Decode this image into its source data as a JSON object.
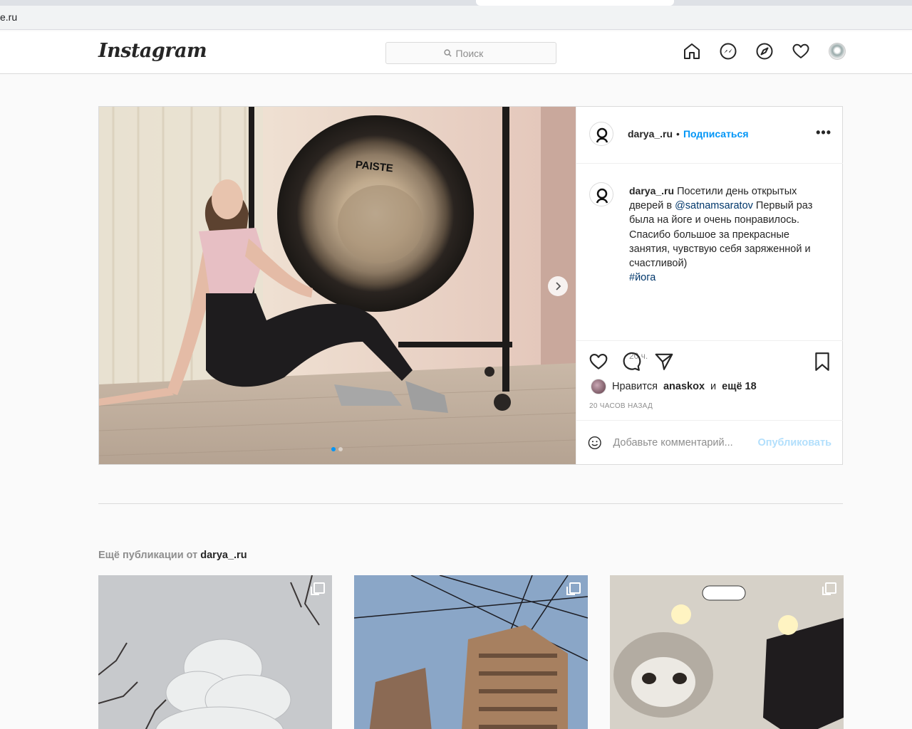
{
  "browser": {
    "url": "e.ru"
  },
  "header": {
    "logo": "Instagram",
    "search_placeholder": "Поиск"
  },
  "post": {
    "username": "darya_.ru",
    "separator": "•",
    "follow_label": "Подписаться",
    "more_label": "•••",
    "brand_on_gong": "PAISTE",
    "caption": {
      "username": "darya_.ru",
      "text_before": " Посетили день открытых дверей в ",
      "mention": "@satnamsaratov",
      "text_after": " Первый раз была на йоге и очень понравилось. Спасибо большое за прекрасные занятия, чувствую себя заряженной и счастливой)",
      "hashtag": "#йога"
    },
    "time_ago": "20 ч.",
    "likes": {
      "prefix": "Нравится",
      "liker": "anaskox",
      "middle": "и",
      "others": "ещё 18"
    },
    "posted_time": "20 ЧАСОВ НАЗАД",
    "comment_placeholder": "Добавьте комментарий...",
    "publish_label": "Опубликовать",
    "carousel": {
      "total": 2,
      "current": 1
    }
  },
  "more_posts": {
    "title_prefix": "Ещё публикации от",
    "username": "darya_.ru",
    "count": 3
  },
  "colors": {
    "accent": "#0095f6",
    "border": "#dbdbdb",
    "muted": "#8e8e8e",
    "link_dark": "#00376b"
  }
}
